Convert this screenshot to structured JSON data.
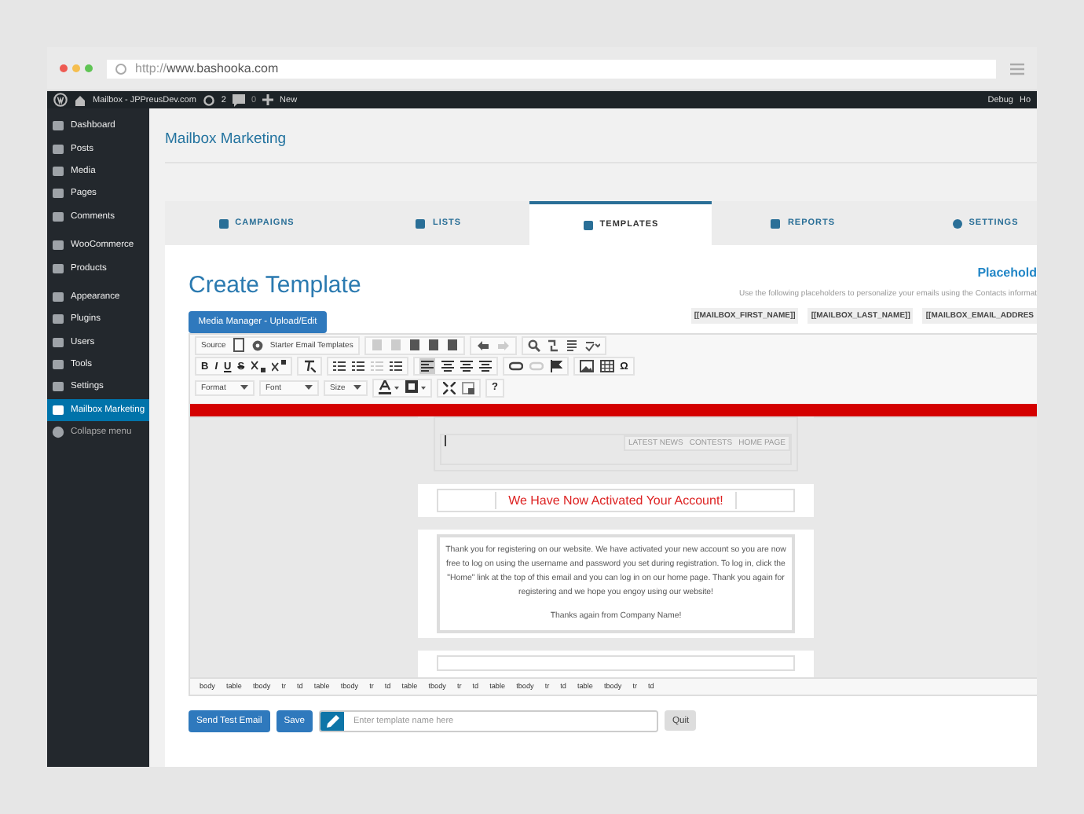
{
  "browser": {
    "url_prefix": "http://",
    "url_domain": "www.bashooka.com"
  },
  "admin_bar": {
    "site": "Mailbox - JPPreusDev.com",
    "updates": "2",
    "comments": "0",
    "new": "New",
    "right": [
      "Debug",
      "Ho"
    ]
  },
  "sidebar": {
    "items": [
      {
        "label": "Dashboard",
        "selected": false
      },
      {
        "label": "Posts",
        "selected": false
      },
      {
        "label": "Media",
        "selected": false
      },
      {
        "label": "Pages",
        "selected": false
      },
      {
        "label": "Comments",
        "selected": false
      },
      {
        "label": "WooCommerce",
        "selected": false
      },
      {
        "label": "Products",
        "selected": false
      },
      {
        "label": "Appearance",
        "selected": false
      },
      {
        "label": "Plugins",
        "selected": false
      },
      {
        "label": "Users",
        "selected": false
      },
      {
        "label": "Tools",
        "selected": false
      },
      {
        "label": "Settings",
        "selected": false
      },
      {
        "label": "Mailbox Marketing",
        "selected": true
      }
    ],
    "collapse": "Collapse menu"
  },
  "page_title": "Mailbox Marketing",
  "tabs": [
    {
      "label": "CAMPAIGNS",
      "selected": false
    },
    {
      "label": "LISTS",
      "selected": false
    },
    {
      "label": "TEMPLATES",
      "selected": true
    },
    {
      "label": "REPORTS",
      "selected": false
    },
    {
      "label": "SETTINGS",
      "selected": false
    }
  ],
  "heading": "Create Template",
  "media_button": "Media Manager - Upload/Edit",
  "placeholders": {
    "title": "Placehold",
    "description": "Use the following placeholders to personalize your emails using the Contacts informat",
    "chips": [
      "[[MAILBOX_FIRST_NAME]]",
      "[[MAILBOX_LAST_NAME]]",
      "[[MAILBOX_EMAIL_ADDRES"
    ]
  },
  "toolbar": {
    "source": "Source",
    "starter": "Starter Email Templates",
    "format_buttons": [
      "B",
      "I",
      "U",
      "S"
    ],
    "omega": "Ω",
    "help": "?",
    "align_left_active": true,
    "dropdowns": [
      "Format",
      "Font",
      "Size"
    ]
  },
  "email": {
    "nav": [
      "LATEST NEWS",
      "CONTESTS",
      "HOME PAGE"
    ],
    "headline": "We Have Now Activated Your Account!",
    "body": "Thank you for registering on our website. We have activated your new account so you are now free to log on using the username and password you set during registration. To log in, click the \"Home\" link at the top of this email and you can log in on our home page. Thank you again for registering and we hope you engoy using our website!",
    "closing": "Thanks again from Company Name!"
  },
  "path": [
    "body",
    "table",
    "tbody",
    "tr",
    "td",
    "table",
    "tbody",
    "tr",
    "td",
    "table",
    "tbody",
    "tr",
    "td",
    "table",
    "tbody",
    "tr",
    "td",
    "table",
    "tbody",
    "tr",
    "td"
  ],
  "actions": {
    "send": "Send Test Email",
    "save": "Save",
    "name_placeholder": "Enter template name here",
    "quit": "Quit"
  }
}
